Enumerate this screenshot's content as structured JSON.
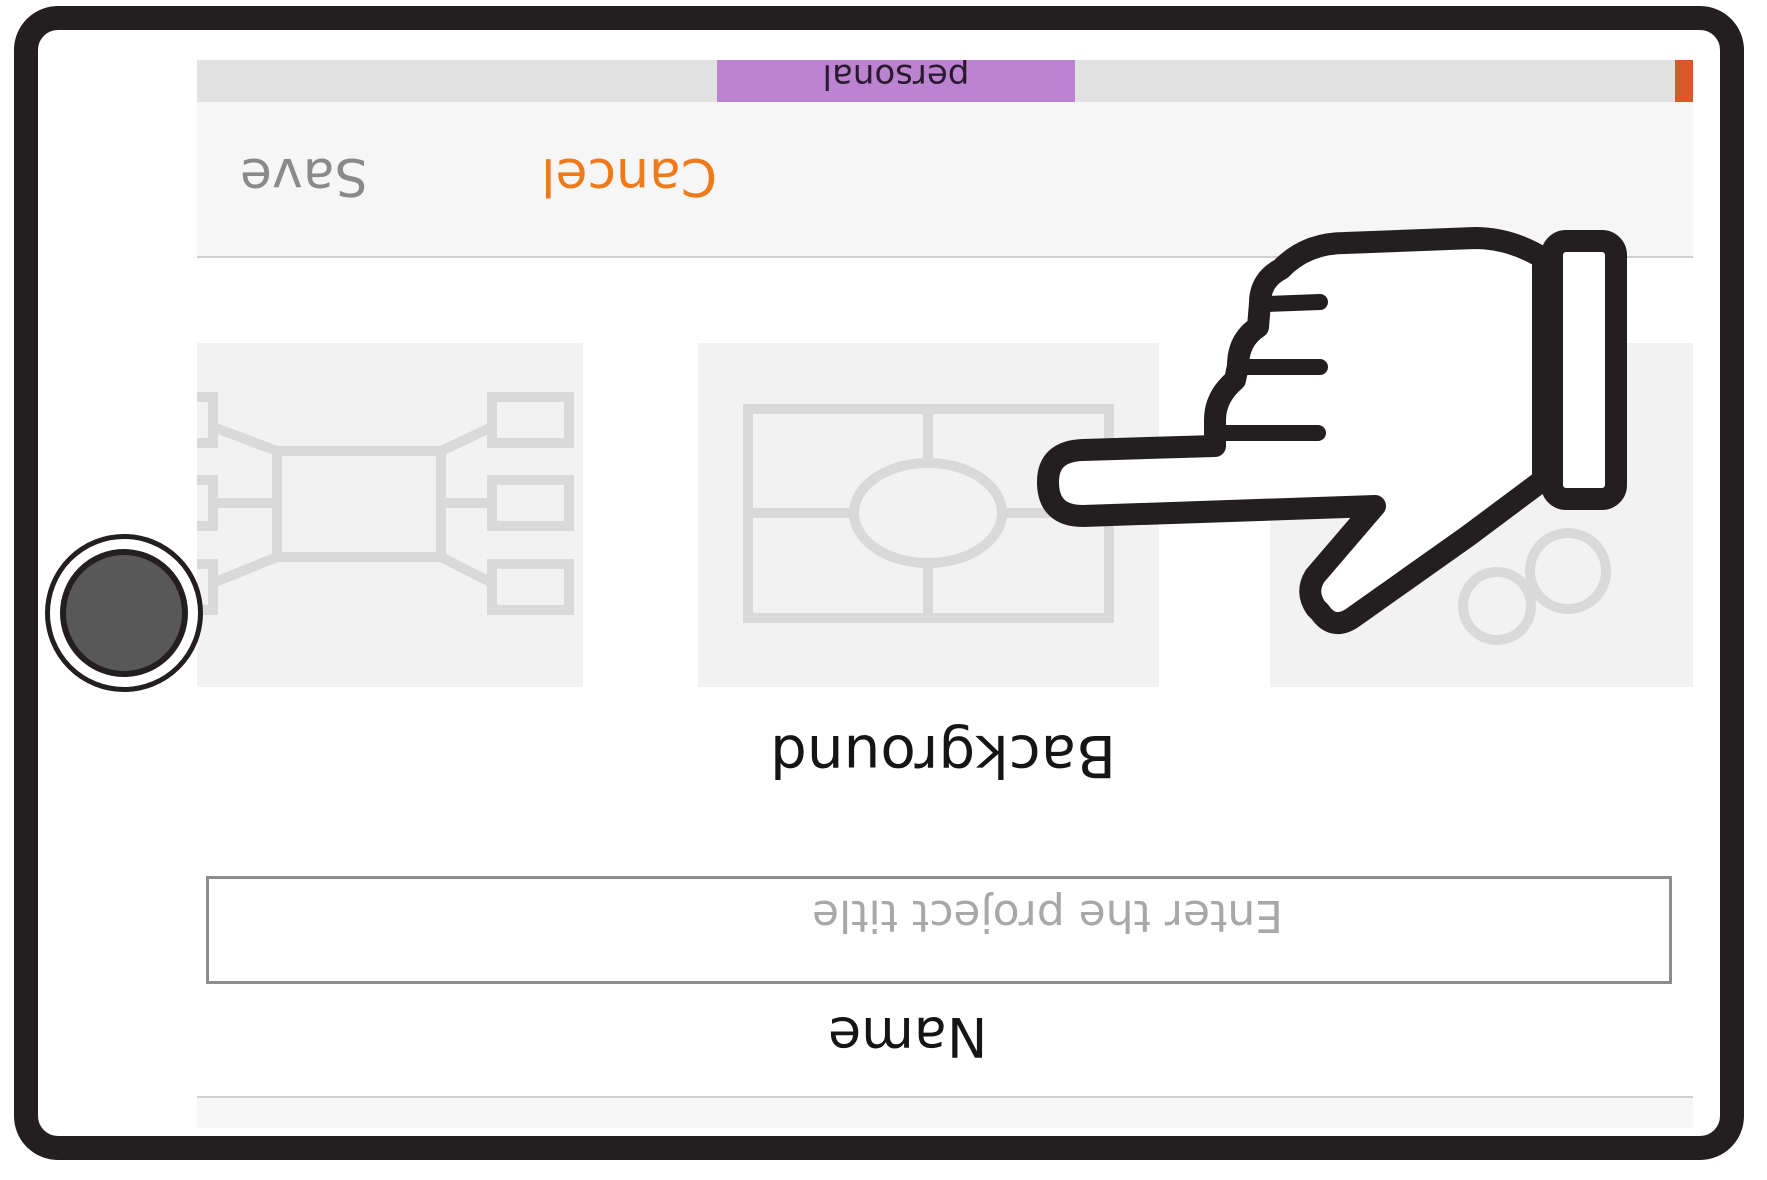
{
  "top_card": {
    "text": "personal"
  },
  "toolbar": {
    "save_label": "Save",
    "cancel_label": "Cancel"
  },
  "templates": {
    "section_label": "Background"
  },
  "name_field": {
    "label": "Name",
    "placeholder": "Enter the project title",
    "value": ""
  },
  "colors": {
    "accent": "#ef7a1a",
    "purple_card": "#bb83d0",
    "frame": "#231f20",
    "header_bg": "#f6f6f6",
    "tile_bg": "#f2f2f2",
    "template_stroke": "#d9d9d9"
  },
  "icons": {
    "overlay": "pointing-hand-icon",
    "home": "home-button-icon"
  },
  "orientation": "upside-down"
}
